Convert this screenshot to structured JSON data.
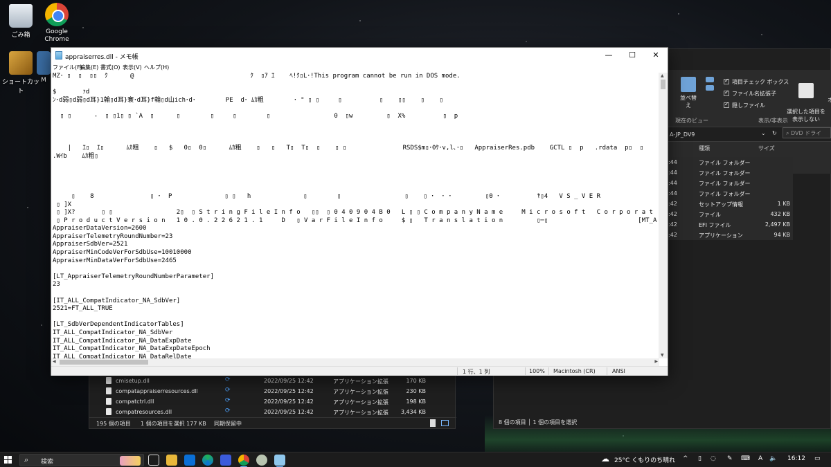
{
  "desktop": {
    "icons": [
      {
        "label": "ごみ箱"
      },
      {
        "label": "Google Chrome"
      },
      {
        "label": "ショートカット"
      },
      {
        "label": "M"
      }
    ]
  },
  "notepad": {
    "title": "appraiserres.dll - メモ帳",
    "controls": {
      "minimize": "—",
      "maximize": "☐",
      "close": "✕"
    },
    "menu": [
      "ファイル(F)",
      "編集(E)",
      "書式(O)",
      "表示(V)",
      "ヘルプ(H)"
    ],
    "lines": [
      "MZ･ ▯  ▯  ▯▯  ｸ      @                               ｸ  ▯ｱ ｴ    ﾍ!ｸ▯L･!This program cannot be run in DOS mode.",
      "",
      "$       ｧd",
      "ﾝ･d弱▯d弱▯d耳}1翰▯d耳}寰･d耳}f翰▯d山ich･d･        PE  d･ ﾑｶ粗        ･ \" ▯ ▯     ▯          ▯    ▯▯    ▯    ▯",
      "",
      "  ▯ ▯      ‐  ▯ ▯1▯ ▯ `A  ▯      ▯        ▯     ▯        ▯                 0  ▯w         ▯  X%          ▯  p",
      "",
      "",
      "",
      "    |   ｴ▯  ｴ▯      ﾑｶ粗    ▯   $   0▯  0▯      ﾑｶ粗    ▯   ▯   T▯  T▯  ▯    ▯ ▯               RSDS$m▯･0ｹ･v,l､･▯   AppraiserRes.pdb    GCTL ▯  p   .rdata  p▯  ▯",
      ".Wｲb    ﾑｶ粗▯",
      "",
      "",
      "",
      "",
      "     ▯    8               ▯ ･  P              ▯ ▯   h              ▯        ▯                 ▯    ▯ ･  ･ ･         ▯0 ･          ﾔ▯4   V S _ V E R",
      " ▯ ]X",
      " ▯ ]X?       ▯ ▯                 2▯  ▯ S t r i n g F i l e I n f o   ▯▯  ▯ 0 4 0 9 0 4 B 0   L ▯ ▯ C o m p a n y N a m e     M i c r o s o f t   C o r p o r a t",
      " ▯ P r o d u c t V e r s i o n   1 0 . 0 . 2 2 6 2 1 . 1     D   ▯ V a r F i l e I n f o     $ ▯   T r a n s l a t i o n         ▯─▯                        [MT_A",
      "AppraiserDataVersion=2600",
      "AppraiserTelemetryRoundNumber=23",
      "AppraiserSdbVer=2521",
      "AppraiserMinCodeVerForSdbUse=10010000",
      "AppraiserMinDataVerForSdbUse=2465",
      "",
      "[LT_AppraiserTelemetryRoundNumberParameter]",
      "23",
      "",
      "[IT_ALL_CompatIndicator_NA_SdbVer]",
      "2521=FT_ALL_TRUE",
      "",
      "[LT_SdbVerDependentIndicatorTables]",
      "IT_ALL_CompatIndicator_NA_SdbVer",
      "IT_ALL_CompatIndicator_NA_DataExpDate",
      "IT_ALL_CompatIndicator_NA_DataExpDateEpoch",
      "IT_ALL_CompatIndicator_NA_DataRelDate"
    ],
    "status": {
      "position": "1 行、1 列",
      "zoom": "100%",
      "eol": "Macintosh (CR)",
      "encoding": "ANSI"
    }
  },
  "explorer_right": {
    "ribbon": {
      "sort_label": "並べ替え",
      "checkboxes": [
        "項目チェック ボックス",
        "ファイル名拡張子",
        "隠しファイル"
      ],
      "hide_selected": "選択した項目を\n表示しない",
      "option_partial": "オ",
      "group_current_view": "現在のビュー",
      "group_show_hide": "表示/非表示"
    },
    "address_partial": "A-JP_DV9",
    "search_placeholder": "DVD ドライ",
    "columns": [
      "種類",
      "サイズ"
    ],
    "rows": [
      {
        "time": ":44",
        "type": "ファイル フォルダー",
        "size": ""
      },
      {
        "time": ":44",
        "type": "ファイル フォルダー",
        "size": ""
      },
      {
        "time": ":44",
        "type": "ファイル フォルダー",
        "size": ""
      },
      {
        "time": ":44",
        "type": "ファイル フォルダー",
        "size": ""
      },
      {
        "time": ":42",
        "type": "セットアップ情報",
        "size": "1 KB"
      },
      {
        "time": ":42",
        "type": "ファイル",
        "size": "432 KB"
      },
      {
        "time": ":42",
        "type": "EFI ファイル",
        "size": "2,497 KB"
      },
      {
        "time": ":42",
        "type": "アプリケーション",
        "size": "94 KB"
      }
    ],
    "status": "8 個の項目 │ 1 個の項目を選択"
  },
  "explorer_left": {
    "rows": [
      {
        "name": "cmisetup.dll",
        "date": "2022/09/25 12:42",
        "type": "アプリケーション拡張",
        "size": "170 KB"
      },
      {
        "name": "compatappraiserresources.dll",
        "date": "2022/09/25 12:42",
        "type": "アプリケーション拡張",
        "size": "230 KB"
      },
      {
        "name": "compatctrl.dll",
        "date": "2022/09/25 12:42",
        "type": "アプリケーション拡張",
        "size": "198 KB"
      },
      {
        "name": "compatresources.dll",
        "date": "2022/09/25 12:42",
        "type": "アプリケーション拡張",
        "size": "3,434 KB"
      }
    ],
    "status": {
      "count": "195 個の項目",
      "selected": "1 個の項目を選択  177 KB",
      "sync": "同期保留中"
    }
  },
  "taskbar": {
    "search_label": "検索",
    "weather": "25°C くもりのち晴れ",
    "ime_label": "A",
    "clock": "16:12"
  }
}
